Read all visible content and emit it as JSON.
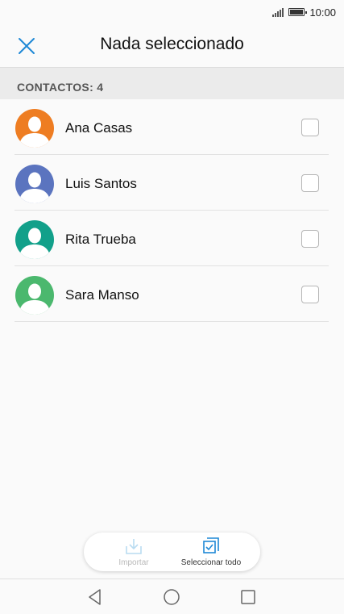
{
  "status_bar": {
    "time": "10:00"
  },
  "header": {
    "title": "Nada seleccionado"
  },
  "section": {
    "label": "CONTACTOS: 4"
  },
  "contacts": [
    {
      "name": "Ana Casas",
      "avatar_color": "#ee7d22",
      "selected": false
    },
    {
      "name": "Luis Santos",
      "avatar_color": "#5b74bf",
      "selected": false
    },
    {
      "name": "Rita Trueba",
      "avatar_color": "#12a08a",
      "selected": false
    },
    {
      "name": "Sara Manso",
      "avatar_color": "#4bb86e",
      "selected": false
    }
  ],
  "actions": {
    "import_label": "Importar",
    "select_all_label": "Seleccionar todo"
  },
  "colors": {
    "accent": "#1e88d6",
    "disabled": "#b9dcf1"
  }
}
